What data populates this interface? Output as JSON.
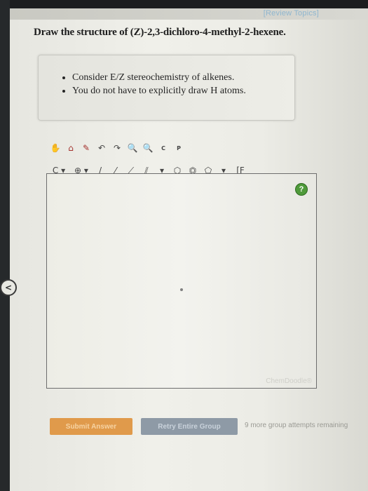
{
  "header": {
    "review_topics": "[Review Topics]"
  },
  "question": {
    "text": "Draw the structure of (Z)-2,3-dichloro-4-methyl-2-hexene."
  },
  "hints": [
    "Consider E/Z stereochemistry of alkenes.",
    "You do not have to explicitly draw H atoms."
  ],
  "toolbar": {
    "row1": [
      {
        "name": "hand-icon",
        "glyph": "✋"
      },
      {
        "name": "lasso-icon",
        "glyph": "⌂"
      },
      {
        "name": "eraser-icon",
        "glyph": "✎"
      },
      {
        "name": "undo-icon",
        "glyph": "↶"
      },
      {
        "name": "redo-icon",
        "glyph": "↷"
      },
      {
        "name": "zoom-in-icon",
        "glyph": "🔍"
      },
      {
        "name": "zoom-out-icon",
        "glyph": "🔍"
      },
      {
        "name": "c-label-icon",
        "glyph": "C"
      },
      {
        "name": "p-label-icon",
        "glyph": "P"
      }
    ],
    "row2": [
      {
        "name": "carbon-atom-dropdown",
        "glyph": "C ▾"
      },
      {
        "name": "charge-plus-dropdown",
        "glyph": "⊕ ▾"
      },
      {
        "name": "single-bond-icon",
        "glyph": "/"
      },
      {
        "name": "wedge-bond-icon",
        "glyph": "⁄"
      },
      {
        "name": "bold-bond-icon",
        "glyph": "⟋"
      },
      {
        "name": "double-bond-icon",
        "glyph": "⫽"
      },
      {
        "name": "bond-dropdown-icon",
        "glyph": "▾"
      },
      {
        "name": "cyclohexane-icon",
        "glyph": "⬡"
      },
      {
        "name": "benzene-icon",
        "glyph": "⏣"
      },
      {
        "name": "cyclopentane-icon",
        "glyph": "⬠"
      },
      {
        "name": "ring-dropdown-icon",
        "glyph": "▾"
      },
      {
        "name": "bracket-icon",
        "glyph": "[F"
      }
    ]
  },
  "canvas": {
    "help": "?",
    "watermark": "ChemDoodle®"
  },
  "buttons": {
    "submit": "Submit Answer",
    "retry": "Retry Entire Group",
    "attempts": "9 more group attempts remaining"
  },
  "side": {
    "arrow": "<"
  }
}
